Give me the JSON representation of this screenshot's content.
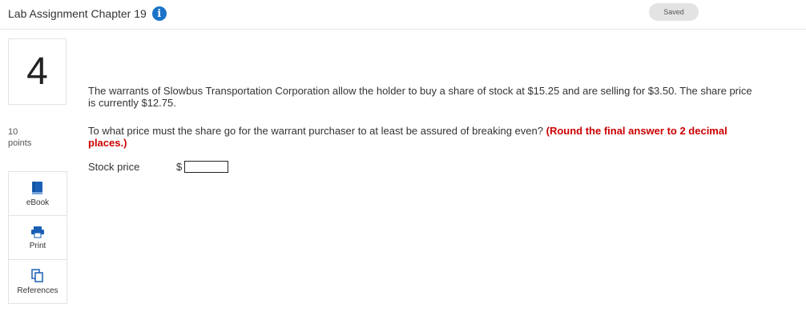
{
  "header": {
    "title": "Lab Assignment Chapter 19",
    "saved_label": "Saved"
  },
  "question": {
    "number": "4",
    "points_value": "10",
    "points_label": "points",
    "text": "The warrants of Slowbus Transportation Corporation allow the holder to buy a share of stock at $15.25 and are selling for $3.50. The share price is currently $12.75.",
    "prompt": "To what price must the share go for the warrant purchaser to at least be assured of breaking even?",
    "instruction": "(Round the final answer to 2 decimal places.)",
    "answer_label": "Stock price",
    "currency": "$",
    "answer_value": ""
  },
  "tools": [
    {
      "label": "eBook",
      "icon": "book-icon"
    },
    {
      "label": "Print",
      "icon": "printer-icon"
    },
    {
      "label": "References",
      "icon": "references-icon"
    }
  ],
  "colors": {
    "accent": "#1a73c8",
    "hint_red": "#cc0000"
  }
}
